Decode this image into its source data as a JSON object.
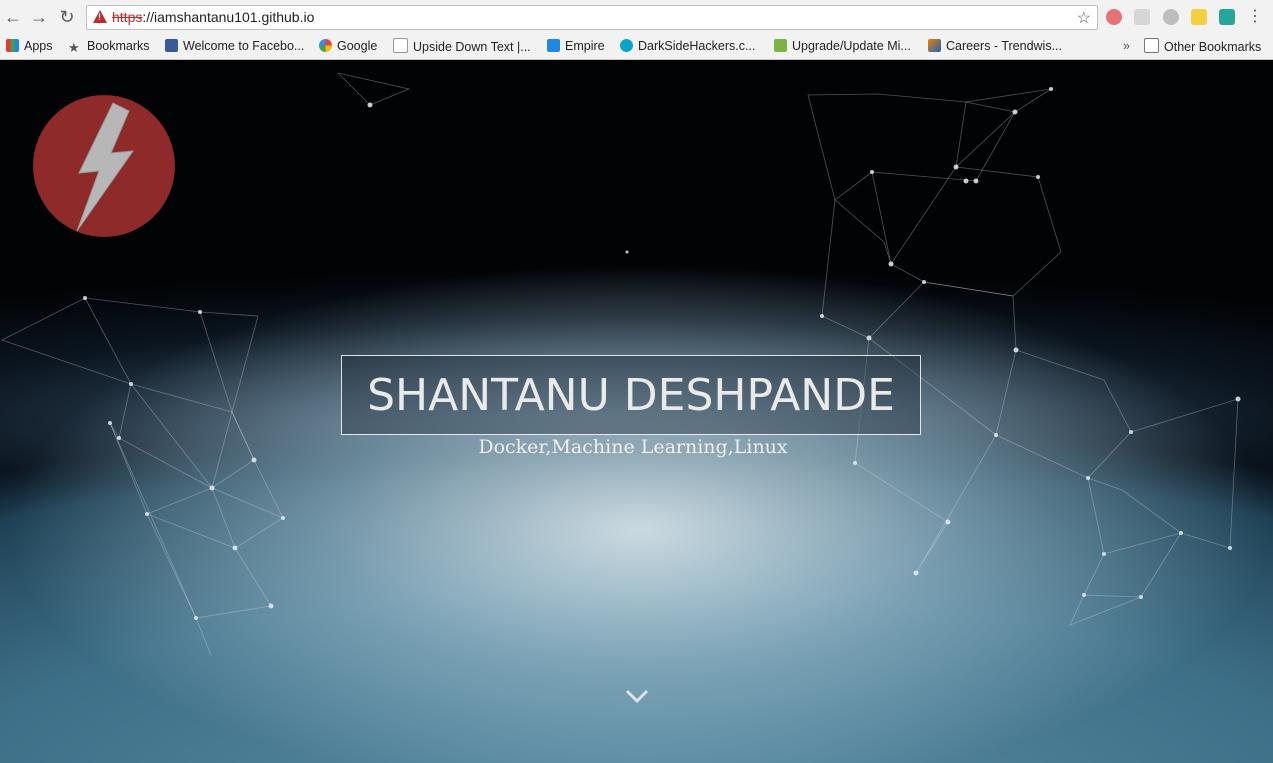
{
  "browser": {
    "url_scheme": "https",
    "url_rest": "://iamshantanu101.github.io",
    "back_icon": "back-arrow-icon",
    "forward_icon": "forward-arrow-icon",
    "reload_icon": "reload-icon"
  },
  "bookmarks": {
    "apps": "Apps",
    "items": [
      {
        "label": "Bookmarks"
      },
      {
        "label": "Welcome to Facebo..."
      },
      {
        "label": "Google"
      },
      {
        "label": "Upside Down Text |..."
      },
      {
        "label": "Empire"
      },
      {
        "label": "DarkSideHackers.c..."
      },
      {
        "label": "Upgrade/Update Mi..."
      },
      {
        "label": "Careers - Trendwis..."
      }
    ],
    "overflow": "»",
    "other": "Other Bookmarks"
  },
  "hero": {
    "title": "SHANTANU DESHPANDE",
    "subtitle": "Docker,Machine Learning,Linux"
  },
  "colors": {
    "logo": "#8e2a2a",
    "warning": "#c62828"
  }
}
